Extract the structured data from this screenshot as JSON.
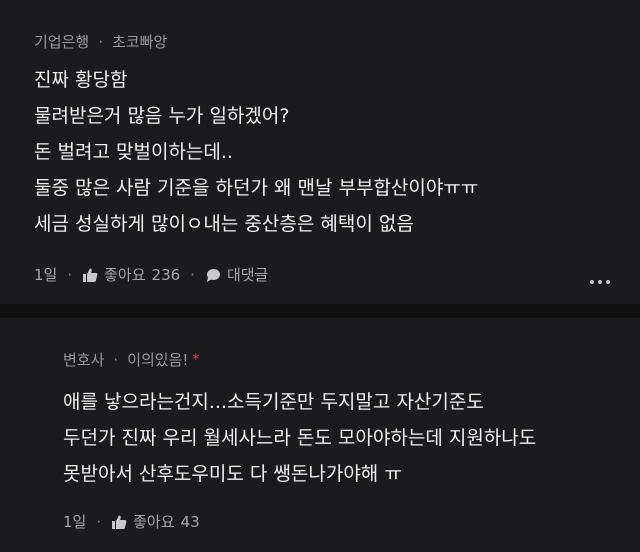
{
  "comments": [
    {
      "company": "기업은행",
      "username": "초코빠앙",
      "lines": [
        "진짜 황당함",
        "물려받은거 많음 누가 일하겠어?",
        "돈 벌려고 맞벌이하는데..",
        "둘중 많은 사람 기준을 하던가 왜 맨날 부부합산이야ㅠㅠ",
        "세금 성실하게 많이ㅇ내는 중산층은 혜택이 없음"
      ],
      "time": "1일",
      "like_label": "좋아요",
      "like_count": "236",
      "reply_label": "대댓글"
    },
    {
      "company": "변호사",
      "username": "이의있음!",
      "badge": "*",
      "lines": [
        "애를 낳으라는건지...소득기준만 두지말고 자산기준도",
        "두던가 진짜 우리 월세사느라 돈도 모아야하는데 지원하나도",
        "못받아서 산후도우미도 다 쌩돈나가야해 ㅠ"
      ],
      "time": "1일",
      "like_label": "좋아요",
      "like_count": "43"
    }
  ],
  "separator": "·",
  "icons": {
    "like": "thumbs-up-icon",
    "reply": "speech-bubble-icon",
    "more": "more-dots-icon"
  }
}
